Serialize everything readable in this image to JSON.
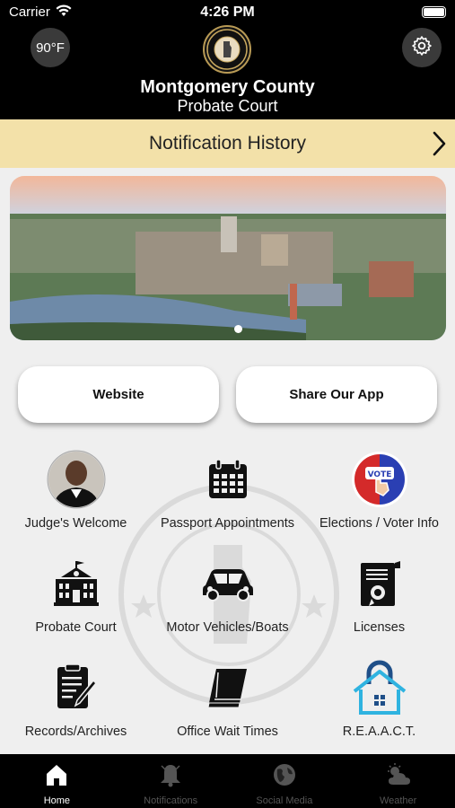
{
  "status_bar": {
    "carrier": "Carrier",
    "time": "4:26 PM"
  },
  "header": {
    "temperature": "90°F",
    "title": "Montgomery County",
    "subtitle": "Probate Court"
  },
  "notification_bar": {
    "label": "Notification History"
  },
  "actions": {
    "website": "Website",
    "share": "Share Our App"
  },
  "grid": [
    {
      "label": "Judge's Welcome",
      "icon": "judge-photo"
    },
    {
      "label": "Passport Appointments",
      "icon": "calendar-icon"
    },
    {
      "label": "Elections / Voter Info",
      "icon": "vote-icon"
    },
    {
      "label": "Probate Court",
      "icon": "courthouse-icon"
    },
    {
      "label": "Motor Vehicles/Boats",
      "icon": "car-icon"
    },
    {
      "label": "Licenses",
      "icon": "license-icon"
    },
    {
      "label": "Records/Archives",
      "icon": "records-icon"
    },
    {
      "label": "Office Wait Times",
      "icon": "book-icon"
    },
    {
      "label": "R.E.A.A.C.T.",
      "icon": "home-lock-icon"
    }
  ],
  "tabs": [
    {
      "label": "Home",
      "icon": "home-icon",
      "active": true
    },
    {
      "label": "Notifications",
      "icon": "bell-icon",
      "active": false
    },
    {
      "label": "Social Media",
      "icon": "globe-icon",
      "active": false
    },
    {
      "label": "Weather",
      "icon": "weather-icon",
      "active": false
    }
  ],
  "colors": {
    "accent": "#f3e1a9",
    "header": "#000000",
    "background": "#efefef"
  }
}
